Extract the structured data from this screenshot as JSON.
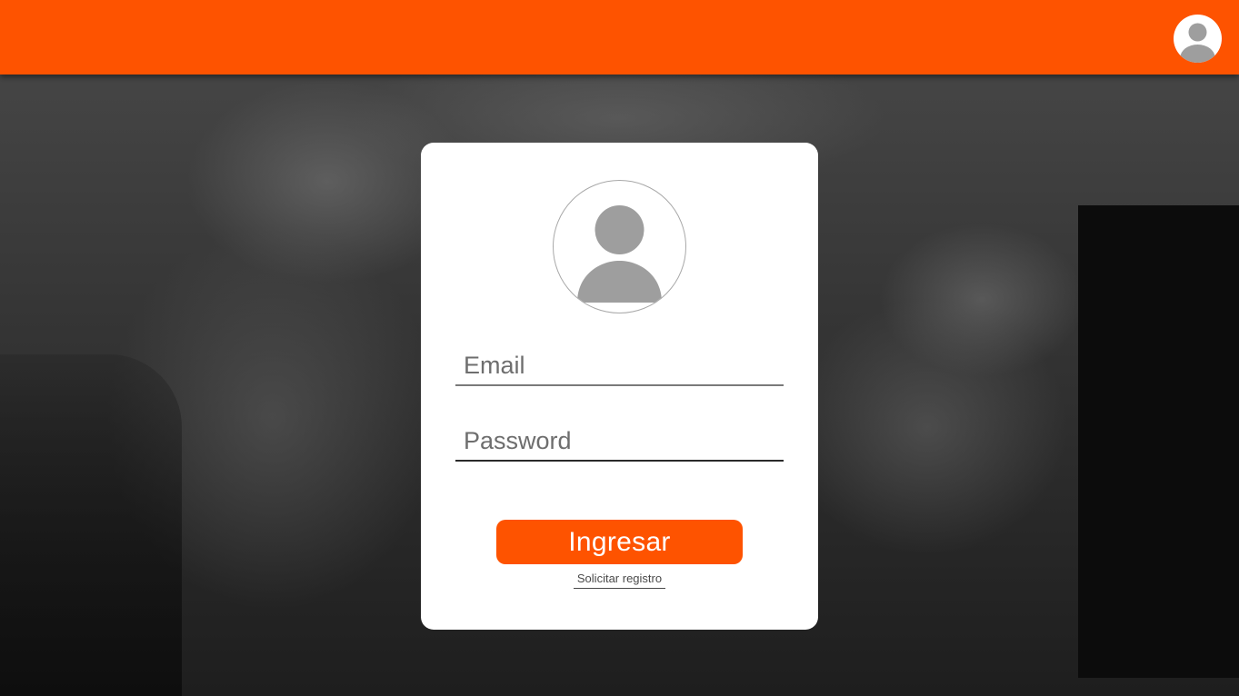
{
  "colors": {
    "accent": "#fe5300",
    "card_background": "#ffffff",
    "avatar_fill": "#9e9e9e"
  },
  "header": {
    "avatar_icon": "user-avatar-icon"
  },
  "login_card": {
    "avatar_icon": "user-avatar-icon",
    "email": {
      "placeholder": "Email",
      "value": ""
    },
    "password": {
      "placeholder": "Password",
      "value": ""
    },
    "submit_label": "Ingresar",
    "register_link": "Solicitar registro"
  }
}
